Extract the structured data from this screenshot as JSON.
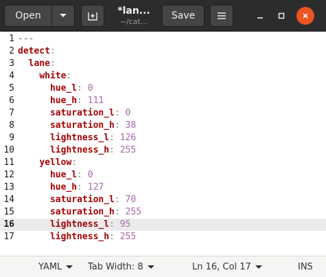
{
  "header": {
    "open_label": "Open",
    "title": "*lan...",
    "subtitle": "~/cat...",
    "save_label": "Save"
  },
  "editor": {
    "current_line": 16,
    "lines": [
      {
        "n": "1",
        "indent": "",
        "key": "",
        "sep": "",
        "value": "---",
        "type": "doc"
      },
      {
        "n": "2",
        "indent": "",
        "key": "detect",
        "sep": ":",
        "value": "",
        "type": "kv"
      },
      {
        "n": "3",
        "indent": "  ",
        "key": "lane",
        "sep": ":",
        "value": "",
        "type": "kv"
      },
      {
        "n": "4",
        "indent": "    ",
        "key": "white",
        "sep": ":",
        "value": "",
        "type": "kv"
      },
      {
        "n": "5",
        "indent": "      ",
        "key": "hue_l",
        "sep": ":",
        "value": "0",
        "type": "kv"
      },
      {
        "n": "6",
        "indent": "      ",
        "key": "hue_h",
        "sep": ":",
        "value": "111",
        "type": "kv"
      },
      {
        "n": "7",
        "indent": "      ",
        "key": "saturation_l",
        "sep": ":",
        "value": "0",
        "type": "kv"
      },
      {
        "n": "8",
        "indent": "      ",
        "key": "saturation_h",
        "sep": ":",
        "value": "38",
        "type": "kv"
      },
      {
        "n": "9",
        "indent": "      ",
        "key": "lightness_l",
        "sep": ":",
        "value": "126",
        "type": "kv"
      },
      {
        "n": "10",
        "indent": "      ",
        "key": "lightness_h",
        "sep": ":",
        "value": "255",
        "type": "kv"
      },
      {
        "n": "11",
        "indent": "    ",
        "key": "yellow",
        "sep": ":",
        "value": "",
        "type": "kv"
      },
      {
        "n": "12",
        "indent": "      ",
        "key": "hue_l",
        "sep": ":",
        "value": "0",
        "type": "kv"
      },
      {
        "n": "13",
        "indent": "      ",
        "key": "hue_h",
        "sep": ":",
        "value": "127",
        "type": "kv"
      },
      {
        "n": "14",
        "indent": "      ",
        "key": "saturation_l",
        "sep": ":",
        "value": "70",
        "type": "kv"
      },
      {
        "n": "15",
        "indent": "      ",
        "key": "saturation_h",
        "sep": ":",
        "value": "255",
        "type": "kv"
      },
      {
        "n": "16",
        "indent": "      ",
        "key": "lightness_l",
        "sep": ":",
        "value": "95",
        "type": "kv"
      },
      {
        "n": "17",
        "indent": "      ",
        "key": "lightness_h",
        "sep": ":",
        "value": "255",
        "type": "kv"
      }
    ]
  },
  "statusbar": {
    "language": "YAML",
    "tab_width": "Tab Width: 8",
    "position": "Ln 16, Col 17",
    "mode": "INS"
  },
  "icons": {
    "dropdown": "chevron-down-icon",
    "new_tab": "new-tab-icon",
    "menu": "hamburger-icon",
    "minimize": "minimize-icon",
    "maximize": "maximize-icon",
    "close": "close-icon"
  },
  "colors": {
    "key": "#a40000",
    "number": "#aa66aa",
    "close_button": "#e95420",
    "header": "#2c2c2c"
  }
}
